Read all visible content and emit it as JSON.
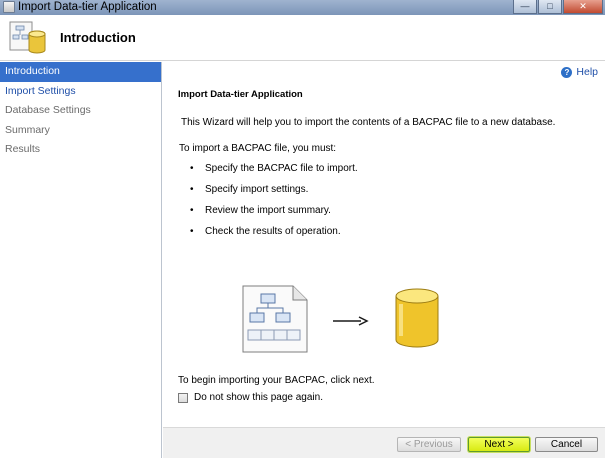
{
  "window": {
    "title": "Import Data-tier Application",
    "controls": {
      "minimize": "—",
      "maximize": "□",
      "close": "✕"
    }
  },
  "header": {
    "title": "Introduction"
  },
  "sidebar": {
    "items": [
      {
        "label": "Introduction",
        "state": "active"
      },
      {
        "label": "Import Settings",
        "state": "link"
      },
      {
        "label": "Database Settings",
        "state": "disabled"
      },
      {
        "label": "Summary",
        "state": "disabled"
      },
      {
        "label": "Results",
        "state": "disabled"
      }
    ]
  },
  "main": {
    "help_label": "Help",
    "section_title": "Import Data-tier Application",
    "description": "This Wizard will help you to import the contents of a BACPAC file to a new database.",
    "intro": "To import a BACPAC file, you must:",
    "steps": [
      "Specify the BACPAC file to import.",
      "Specify import settings.",
      "Review the import summary.",
      "Check the results of operation."
    ],
    "begin_text": "To begin importing your BACPAC, click next.",
    "checkbox_label": "Do not show this page again.",
    "checkbox_checked": false
  },
  "footer": {
    "previous_label": "< Previous",
    "next_label": "Next >",
    "cancel_label": "Cancel"
  },
  "colors": {
    "active_nav": "#3670cc",
    "next_highlight": "#e3f21f",
    "link": "#1f4fa8"
  },
  "icons": [
    "app-icon",
    "wizard-database-icon",
    "help-icon",
    "document-schema-icon",
    "arrow-right-icon",
    "database-cylinder-icon"
  ]
}
